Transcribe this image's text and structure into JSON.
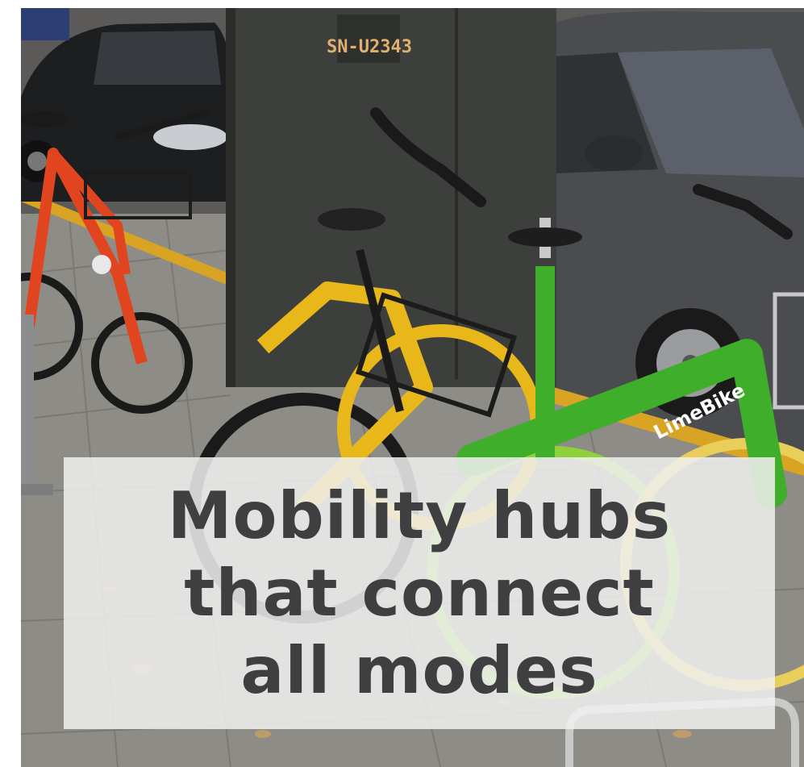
{
  "caption": {
    "line1": "Mobility hubs",
    "line2": "that connect",
    "line3": "all modes"
  },
  "signage": {
    "box_id": "SN-U2343",
    "bike_brand": "LimeBike"
  },
  "colors": {
    "caption_text": "#3f3f41",
    "caption_bg": "#f0f0f0",
    "bike_red": "#e0451f",
    "bike_yellow": "#e8b81a",
    "bike_green": "#3fae2a",
    "cabinet": "#3d3f3c"
  }
}
